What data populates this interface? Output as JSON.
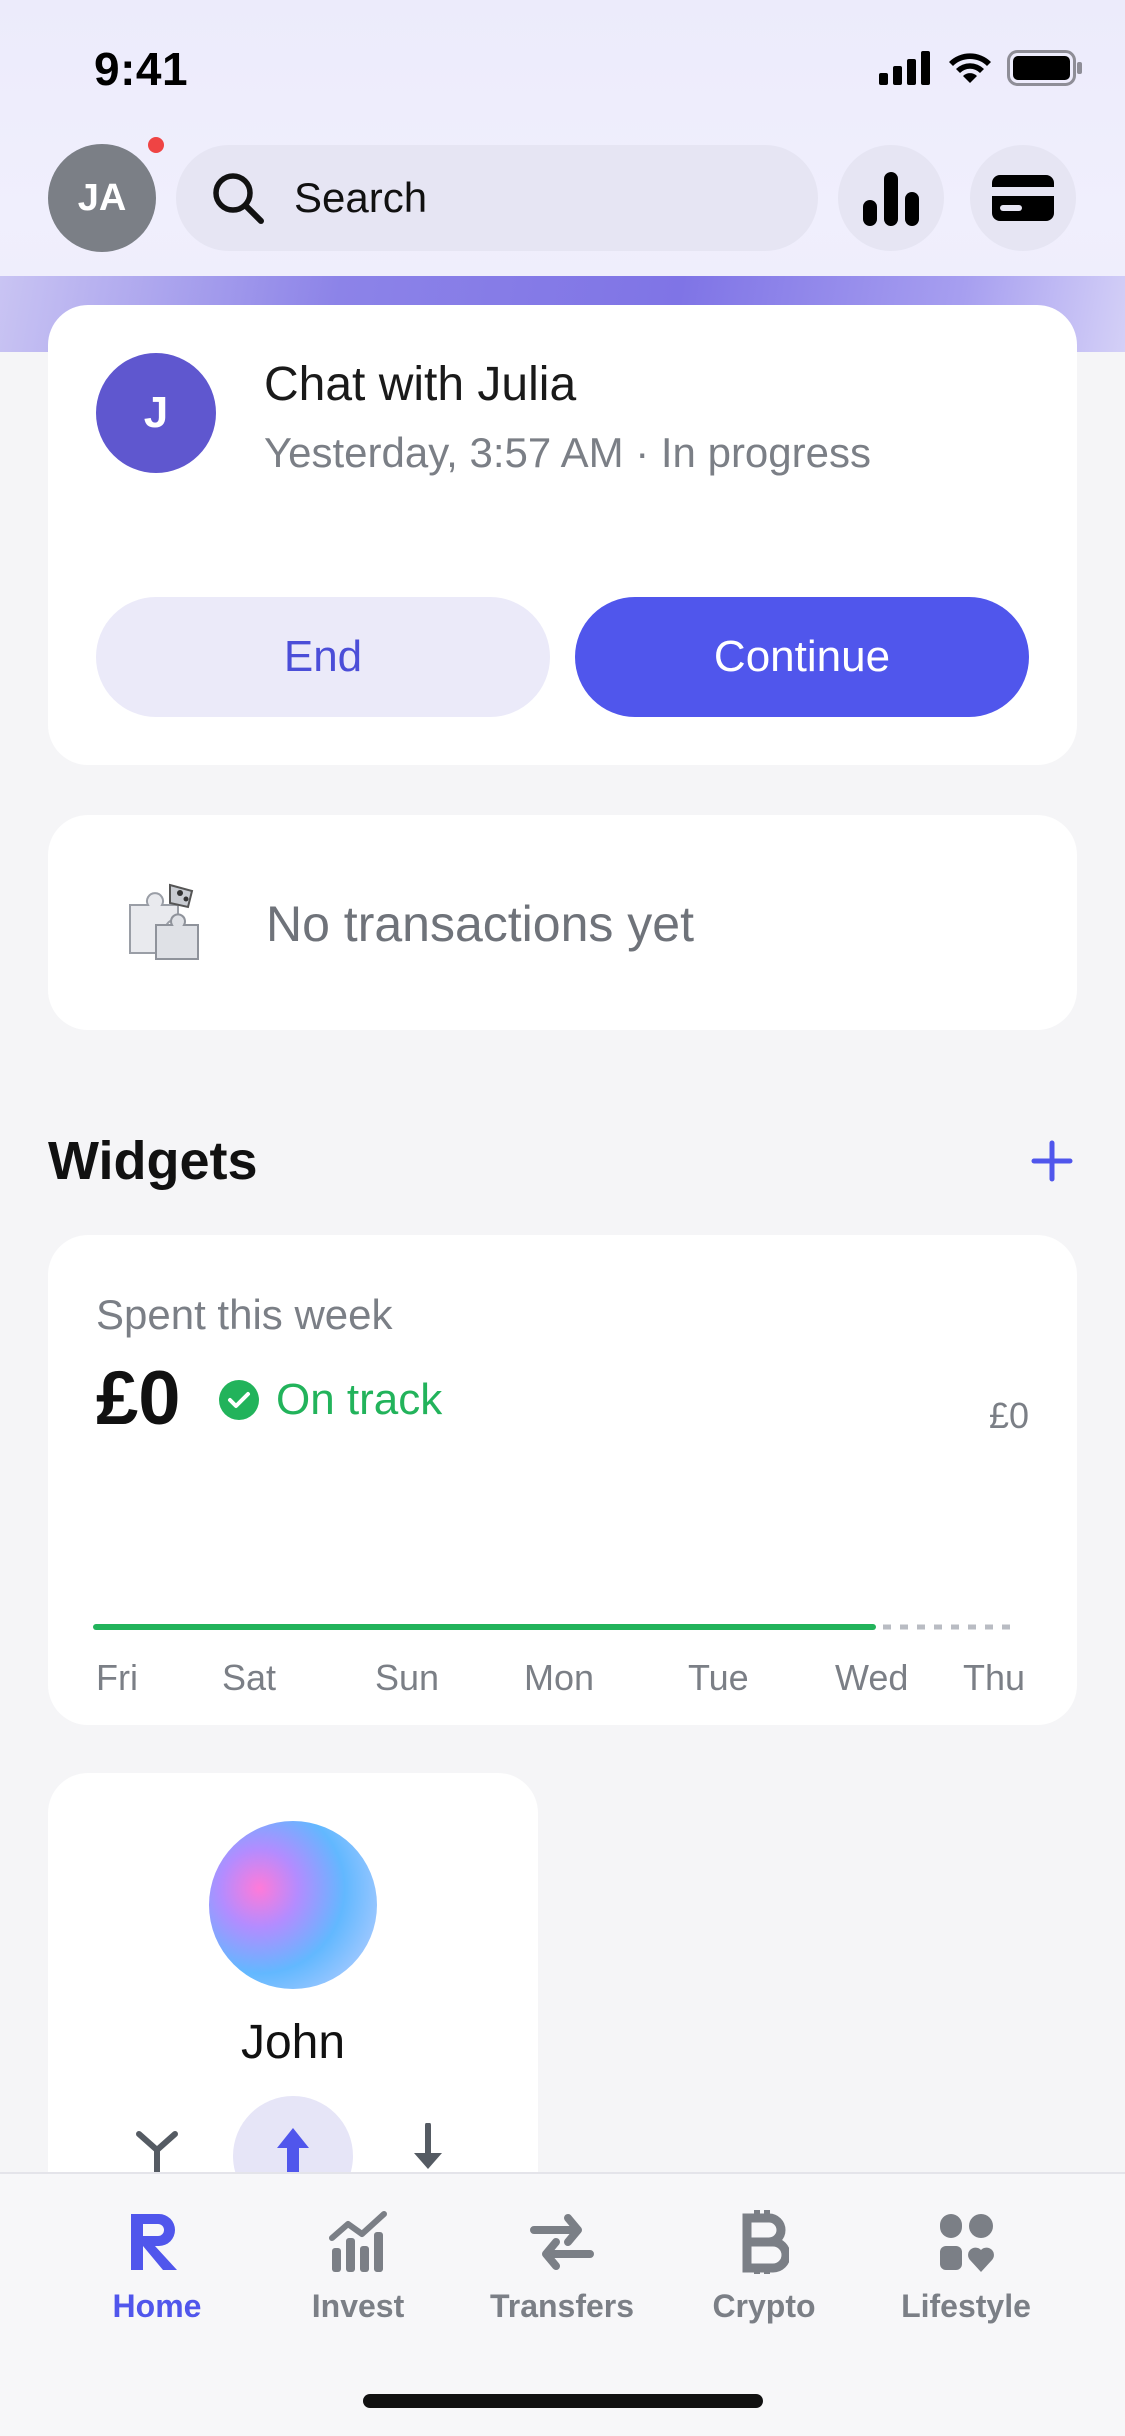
{
  "status": {
    "time": "9:41"
  },
  "header": {
    "avatar_initials": "JA",
    "search_placeholder": "Search"
  },
  "chat": {
    "avatar_initial": "J",
    "title": "Chat with Julia",
    "subtitle": "Yesterday, 3:57 AM · In progress",
    "end_label": "End",
    "continue_label": "Continue"
  },
  "transactions": {
    "empty_label": "No transactions yet"
  },
  "widgets": {
    "title": "Widgets",
    "spent": {
      "label": "Spent this week",
      "amount": "£0",
      "status": "On track",
      "right_value": "£0",
      "days": [
        "Fri",
        "Sat",
        "Sun",
        "Mon",
        "Tue",
        "Wed",
        "Thu"
      ]
    },
    "contact": {
      "name": "John"
    }
  },
  "tabbar": {
    "items": [
      {
        "label": "Home",
        "icon": "revolut-r-icon",
        "active": true
      },
      {
        "label": "Invest",
        "icon": "invest-chart-icon",
        "active": false
      },
      {
        "label": "Transfers",
        "icon": "transfer-arrows-icon",
        "active": false
      },
      {
        "label": "Crypto",
        "icon": "bitcoin-icon",
        "active": false
      },
      {
        "label": "Lifestyle",
        "icon": "lifestyle-grid-icon",
        "active": false
      }
    ]
  },
  "colors": {
    "accent": "#5056ec",
    "success": "#22b35b",
    "muted_text": "#7b7f86"
  }
}
